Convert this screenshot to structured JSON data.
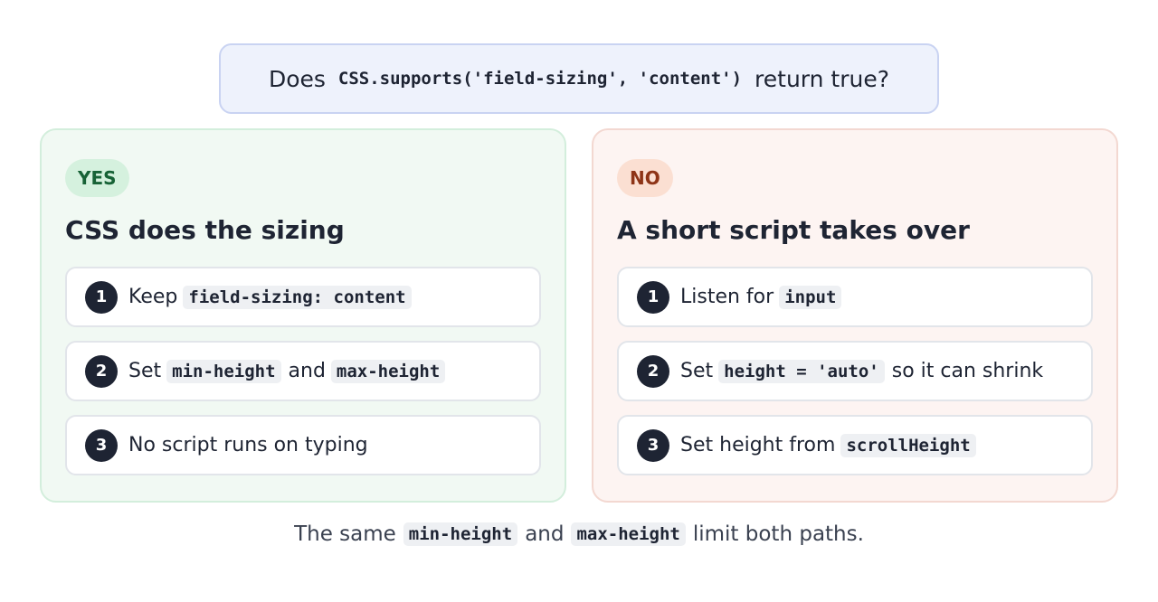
{
  "question": {
    "prefix": "Does",
    "code": "CSS.supports('field-sizing', 'content')",
    "suffix": "return true?"
  },
  "yes_branch": {
    "badge": "YES",
    "title": "CSS does the sizing",
    "steps": [
      {
        "num": "1",
        "text": "Keep",
        "code": "field-sizing: content"
      },
      {
        "num": "2",
        "text": "Set",
        "code": "min-height",
        "text2": "and",
        "code2": "max-height"
      },
      {
        "num": "3",
        "text": "No script runs on typing"
      }
    ]
  },
  "no_branch": {
    "badge": "NO",
    "title": "A short script takes over",
    "steps": [
      {
        "num": "1",
        "text": "Listen for",
        "code": "input"
      },
      {
        "num": "2",
        "text": "Set",
        "code": "height = 'auto'",
        "text2": "so it can shrink"
      },
      {
        "num": "3",
        "text": "Set height from",
        "code": "scrollHeight"
      }
    ]
  },
  "footer": {
    "text1": "The same",
    "code1": "min-height",
    "text2": "and",
    "code2": "max-height",
    "text3": "limit both paths."
  },
  "colors": {
    "yes_panel_bg": "#f1f9f3",
    "yes_badge_text": "#176236",
    "no_panel_bg": "#fdf4f2",
    "no_badge_text": "#8e3417",
    "question_bg": "#eef2fc",
    "number_circle": "#1e2433"
  }
}
